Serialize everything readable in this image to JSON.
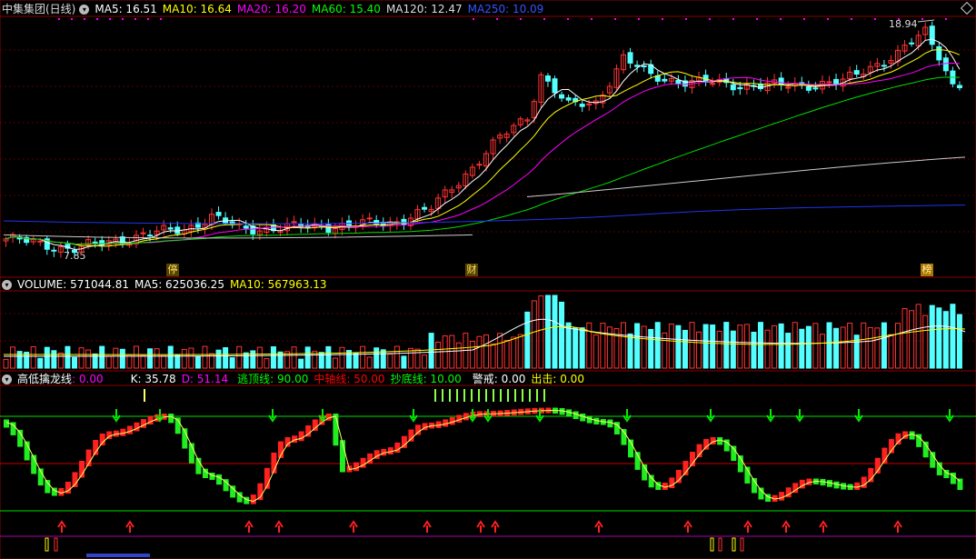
{
  "main_panel": {
    "stock_name": "中集集团(日线)",
    "ma": [
      {
        "label": "MA5: 16.51",
        "color": "#ffffff"
      },
      {
        "label": "MA10: 16.64",
        "color": "#ffff00"
      },
      {
        "label": "MA20: 16.20",
        "color": "#ff00ff"
      },
      {
        "label": "MA60: 15.40",
        "color": "#00ff00"
      },
      {
        "label": "MA120: 12.47",
        "color": "#dddddd"
      },
      {
        "label": "MA250: 10.09",
        "color": "#0000ff"
      }
    ],
    "high_label": "18.94",
    "low_label": "7.85",
    "markers": [
      "停",
      "财",
      "榜"
    ]
  },
  "volume_panel": {
    "title": "VOLUME: 571044.81",
    "ma5": "MA5: 625036.25",
    "ma10": "MA10: 567963.13"
  },
  "indicator_panel": {
    "name": "高低擒龙线",
    "name_value": ": 0.00",
    "k": "K: 35.78",
    "d": "D: 51.14",
    "escape_label": "逃顶线: 90.00",
    "mid_label": "中轴线: 50.00",
    "bottom_label": "抄底线: 10.00",
    "alert_label": "警戒: 0.00",
    "strike_label": "出击: 0.00",
    "levels": [
      90,
      50,
      10
    ]
  },
  "chart_data": {
    "type": "candlestick",
    "title": "中集集团(日线)",
    "ylim": [
      7.85,
      18.94
    ],
    "max_price": 18.94,
    "min_price": 7.85,
    "ma_current": {
      "MA5": 16.51,
      "MA10": 16.64,
      "MA20": 16.2,
      "MA60": 15.4,
      "MA120": 12.47,
      "MA250": 10.09
    },
    "volume_current": 571044.81,
    "volume_ma": {
      "MA5": 625036.25,
      "MA10": 567963.13
    },
    "kd_current": {
      "K": 35.78,
      "D": 51.14
    },
    "indicator_levels": {
      "逃顶线": 90,
      "中轴线": 50,
      "抄底线": 10
    }
  }
}
